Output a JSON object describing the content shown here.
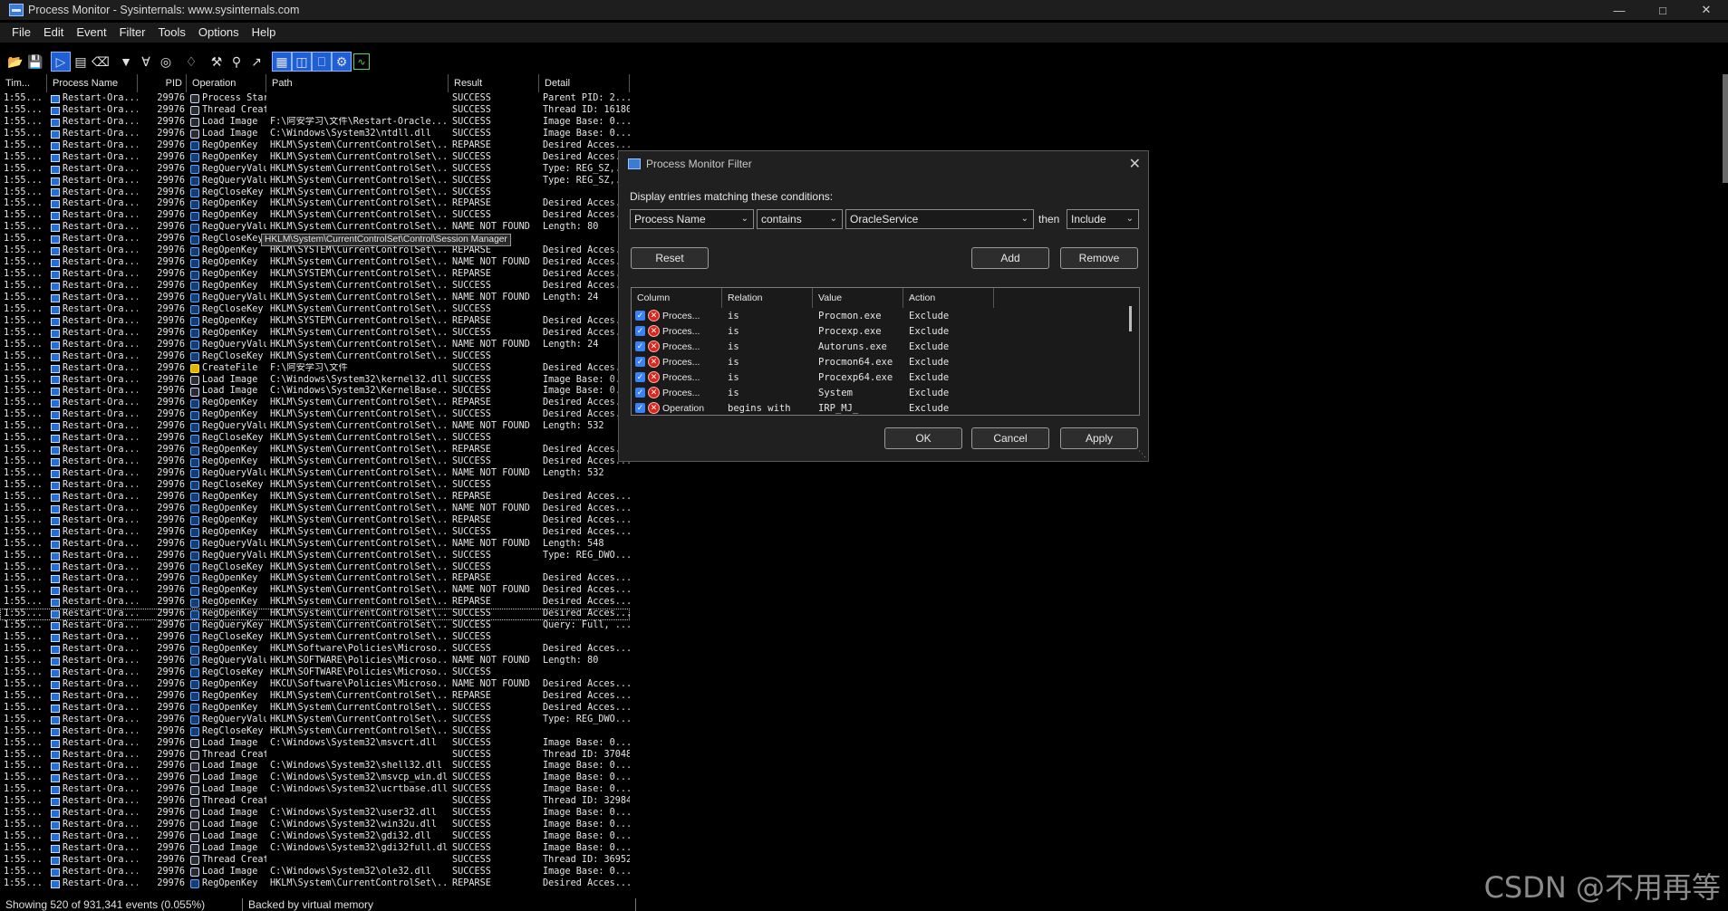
{
  "window": {
    "title": "Process Monitor - Sysinternals: www.sysinternals.com",
    "controls": [
      "minimize-icon",
      "maximize-icon",
      "close-icon"
    ]
  },
  "menu": [
    "File",
    "Edit",
    "Event",
    "Filter",
    "Tools",
    "Options",
    "Help"
  ],
  "toolbar": [
    "open-icon",
    "save-icon",
    "capture-icon",
    "autoscroll-icon",
    "clear-icon",
    "filter-icon",
    "highlight-icon",
    "target-icon",
    "process-tree-icon",
    "wrench-icon",
    "find-icon",
    "jump-icon",
    "registry-activity-icon",
    "file-activity-icon",
    "network-activity-icon",
    "process-activity-icon",
    "profiling-icon"
  ],
  "columns": [
    "Tim...",
    "Process Name",
    "PID",
    "Operation",
    "Path",
    "Result",
    "Detail"
  ],
  "rows": [
    [
      "1:55...",
      "Restart-Ora...",
      "29976",
      "proc",
      "Process Start",
      "",
      "SUCCESS",
      "Parent PID: 2..."
    ],
    [
      "1:55...",
      "Restart-Ora...",
      "29976",
      "proc",
      "Thread Create",
      "",
      "SUCCESS",
      "Thread ID: 16180"
    ],
    [
      "1:55...",
      "Restart-Ora...",
      "29976",
      "proc",
      "Load Image",
      "F:\\阿安学习\\文件\\Restart-Oracle...",
      "SUCCESS",
      "Image Base: 0..."
    ],
    [
      "1:55...",
      "Restart-Ora...",
      "29976",
      "proc",
      "Load Image",
      "C:\\Windows\\System32\\ntdll.dll",
      "SUCCESS",
      "Image Base: 0..."
    ],
    [
      "1:55...",
      "Restart-Ora...",
      "29976",
      "reg",
      "RegOpenKey",
      "HKLM\\System\\CurrentControlSet\\...",
      "REPARSE",
      "Desired Acces..."
    ],
    [
      "1:55...",
      "Restart-Ora...",
      "29976",
      "reg",
      "RegOpenKey",
      "HKLM\\System\\CurrentControlSet\\...",
      "SUCCESS",
      "Desired Acces..."
    ],
    [
      "1:55...",
      "Restart-Ora...",
      "29976",
      "reg",
      "RegQueryValue",
      "HKLM\\System\\CurrentControlSet\\...",
      "SUCCESS",
      "Type: REG_SZ,..."
    ],
    [
      "1:55...",
      "Restart-Ora...",
      "29976",
      "reg",
      "RegQueryValue",
      "HKLM\\System\\CurrentControlSet\\...",
      "SUCCESS",
      "Type: REG_SZ,..."
    ],
    [
      "1:55...",
      "Restart-Ora...",
      "29976",
      "reg",
      "RegCloseKey",
      "HKLM\\System\\CurrentControlSet\\...",
      "SUCCESS",
      ""
    ],
    [
      "1:55...",
      "Restart-Ora...",
      "29976",
      "reg",
      "RegOpenKey",
      "HKLM\\System\\CurrentControlSet\\...",
      "REPARSE",
      "Desired Acces..."
    ],
    [
      "1:55...",
      "Restart-Ora...",
      "29976",
      "reg",
      "RegOpenKey",
      "HKLM\\System\\CurrentControlSet\\...",
      "SUCCESS",
      "Desired Acces..."
    ],
    [
      "1:55...",
      "Restart-Ora...",
      "29976",
      "reg",
      "RegQueryValue",
      "HKLM\\System\\CurrentControlSet\\...",
      "NAME NOT FOUND",
      "Length: 80"
    ],
    [
      "1:55...",
      "Restart-Ora...",
      "29976",
      "reg",
      "RegCloseKey",
      "",
      "",
      ""
    ],
    [
      "1:55...",
      "Restart-Ora...",
      "29976",
      "reg",
      "RegOpenKey",
      "HKLM\\SYSTEM\\CurrentControlSet\\...",
      "REPARSE",
      "Desired Acces..."
    ],
    [
      "1:55...",
      "Restart-Ora...",
      "29976",
      "reg",
      "RegOpenKey",
      "HKLM\\System\\CurrentControlSet\\...",
      "NAME NOT FOUND",
      "Desired Acces..."
    ],
    [
      "1:55...",
      "Restart-Ora...",
      "29976",
      "reg",
      "RegOpenKey",
      "HKLM\\SYSTEM\\CurrentControlSet\\...",
      "REPARSE",
      "Desired Acces..."
    ],
    [
      "1:55...",
      "Restart-Ora...",
      "29976",
      "reg",
      "RegOpenKey",
      "HKLM\\System\\CurrentControlSet\\...",
      "SUCCESS",
      "Desired Acces..."
    ],
    [
      "1:55...",
      "Restart-Ora...",
      "29976",
      "reg",
      "RegQueryValue",
      "HKLM\\System\\CurrentControlSet\\...",
      "NAME NOT FOUND",
      "Length: 24"
    ],
    [
      "1:55...",
      "Restart-Ora...",
      "29976",
      "reg",
      "RegCloseKey",
      "HKLM\\System\\CurrentControlSet\\...",
      "SUCCESS",
      ""
    ],
    [
      "1:55...",
      "Restart-Ora...",
      "29976",
      "reg",
      "RegOpenKey",
      "HKLM\\SYSTEM\\CurrentControlSet\\...",
      "REPARSE",
      "Desired Acces..."
    ],
    [
      "1:55...",
      "Restart-Ora...",
      "29976",
      "reg",
      "RegOpenKey",
      "HKLM\\System\\CurrentControlSet\\...",
      "SUCCESS",
      "Desired Acces..."
    ],
    [
      "1:55...",
      "Restart-Ora...",
      "29976",
      "reg",
      "RegQueryValue",
      "HKLM\\System\\CurrentControlSet\\...",
      "NAME NOT FOUND",
      "Length: 24"
    ],
    [
      "1:55...",
      "Restart-Ora...",
      "29976",
      "reg",
      "RegCloseKey",
      "HKLM\\System\\CurrentControlSet\\...",
      "SUCCESS",
      ""
    ],
    [
      "1:55...",
      "Restart-Ora...",
      "29976",
      "file",
      "CreateFile",
      "F:\\阿安学习\\文件",
      "SUCCESS",
      "Desired Acces..."
    ],
    [
      "1:55...",
      "Restart-Ora...",
      "29976",
      "proc",
      "Load Image",
      "C:\\Windows\\System32\\kernel32.dll",
      "SUCCESS",
      "Image Base: 0..."
    ],
    [
      "1:55...",
      "Restart-Ora...",
      "29976",
      "proc",
      "Load Image",
      "C:\\Windows\\System32\\KernelBase...",
      "SUCCESS",
      "Image Base: 0..."
    ],
    [
      "1:55...",
      "Restart-Ora...",
      "29976",
      "reg",
      "RegOpenKey",
      "HKLM\\System\\CurrentControlSet\\...",
      "REPARSE",
      "Desired Acces..."
    ],
    [
      "1:55...",
      "Restart-Ora...",
      "29976",
      "reg",
      "RegOpenKey",
      "HKLM\\System\\CurrentControlSet\\...",
      "SUCCESS",
      "Desired Acces..."
    ],
    [
      "1:55...",
      "Restart-Ora...",
      "29976",
      "reg",
      "RegQueryValue",
      "HKLM\\System\\CurrentControlSet\\...",
      "NAME NOT FOUND",
      "Length: 532"
    ],
    [
      "1:55...",
      "Restart-Ora...",
      "29976",
      "reg",
      "RegCloseKey",
      "HKLM\\System\\CurrentControlSet\\...",
      "SUCCESS",
      ""
    ],
    [
      "1:55...",
      "Restart-Ora...",
      "29976",
      "reg",
      "RegOpenKey",
      "HKLM\\System\\CurrentControlSet\\...",
      "REPARSE",
      "Desired Acces..."
    ],
    [
      "1:55...",
      "Restart-Ora...",
      "29976",
      "reg",
      "RegOpenKey",
      "HKLM\\System\\CurrentControlSet\\...",
      "SUCCESS",
      "Desired Acces..."
    ],
    [
      "1:55...",
      "Restart-Ora...",
      "29976",
      "reg",
      "RegQueryValue",
      "HKLM\\System\\CurrentControlSet\\...",
      "NAME NOT FOUND",
      "Length: 532"
    ],
    [
      "1:55...",
      "Restart-Ora...",
      "29976",
      "reg",
      "RegCloseKey",
      "HKLM\\System\\CurrentControlSet\\...",
      "SUCCESS",
      ""
    ],
    [
      "1:55...",
      "Restart-Ora...",
      "29976",
      "reg",
      "RegOpenKey",
      "HKLM\\System\\CurrentControlSet\\...",
      "REPARSE",
      "Desired Acces..."
    ],
    [
      "1:55...",
      "Restart-Ora...",
      "29976",
      "reg",
      "RegOpenKey",
      "HKLM\\System\\CurrentControlSet\\...",
      "NAME NOT FOUND",
      "Desired Acces..."
    ],
    [
      "1:55...",
      "Restart-Ora...",
      "29976",
      "reg",
      "RegOpenKey",
      "HKLM\\System\\CurrentControlSet\\...",
      "REPARSE",
      "Desired Acces..."
    ],
    [
      "1:55...",
      "Restart-Ora...",
      "29976",
      "reg",
      "RegOpenKey",
      "HKLM\\System\\CurrentControlSet\\...",
      "SUCCESS",
      "Desired Acces..."
    ],
    [
      "1:55...",
      "Restart-Ora...",
      "29976",
      "reg",
      "RegQueryValue",
      "HKLM\\System\\CurrentControlSet\\...",
      "NAME NOT FOUND",
      "Length: 548"
    ],
    [
      "1:55...",
      "Restart-Ora...",
      "29976",
      "reg",
      "RegQueryValue",
      "HKLM\\System\\CurrentControlSet\\...",
      "SUCCESS",
      "Type: REG_DWO..."
    ],
    [
      "1:55...",
      "Restart-Ora...",
      "29976",
      "reg",
      "RegCloseKey",
      "HKLM\\System\\CurrentControlSet\\...",
      "SUCCESS",
      ""
    ],
    [
      "1:55...",
      "Restart-Ora...",
      "29976",
      "reg",
      "RegOpenKey",
      "HKLM\\System\\CurrentControlSet\\...",
      "REPARSE",
      "Desired Acces..."
    ],
    [
      "1:55...",
      "Restart-Ora...",
      "29976",
      "reg",
      "RegOpenKey",
      "HKLM\\System\\CurrentControlSet\\...",
      "NAME NOT FOUND",
      "Desired Acces..."
    ],
    [
      "1:55...",
      "Restart-Ora...",
      "29976",
      "reg",
      "RegOpenKey",
      "HKLM\\System\\CurrentControlSet\\...",
      "REPARSE",
      "Desired Acces..."
    ],
    [
      "1:55...",
      "Restart-Ora...",
      "29976",
      "reg",
      "RegOpenKey",
      "HKLM\\System\\CurrentControlSet\\...",
      "SUCCESS",
      "Desired Acces..."
    ],
    [
      "1:55...",
      "Restart-Ora...",
      "29976",
      "reg",
      "RegQueryKey",
      "HKLM\\System\\CurrentControlSet\\...",
      "SUCCESS",
      "Query: Full, ..."
    ],
    [
      "1:55...",
      "Restart-Ora...",
      "29976",
      "reg",
      "RegCloseKey",
      "HKLM\\System\\CurrentControlSet\\...",
      "SUCCESS",
      ""
    ],
    [
      "1:55...",
      "Restart-Ora...",
      "29976",
      "reg",
      "RegOpenKey",
      "HKLM\\Software\\Policies\\Microso...",
      "SUCCESS",
      "Desired Acces..."
    ],
    [
      "1:55...",
      "Restart-Ora...",
      "29976",
      "reg",
      "RegQueryValue",
      "HKLM\\SOFTWARE\\Policies\\Microso...",
      "NAME NOT FOUND",
      "Length: 80"
    ],
    [
      "1:55...",
      "Restart-Ora...",
      "29976",
      "reg",
      "RegCloseKey",
      "HKLM\\SOFTWARE\\Policies\\Microso...",
      "SUCCESS",
      ""
    ],
    [
      "1:55...",
      "Restart-Ora...",
      "29976",
      "reg",
      "RegOpenKey",
      "HKCU\\Software\\Policies\\Microso...",
      "NAME NOT FOUND",
      "Desired Acces..."
    ],
    [
      "1:55...",
      "Restart-Ora...",
      "29976",
      "reg",
      "RegOpenKey",
      "HKLM\\System\\CurrentControlSet\\...",
      "REPARSE",
      "Desired Acces..."
    ],
    [
      "1:55...",
      "Restart-Ora...",
      "29976",
      "reg",
      "RegOpenKey",
      "HKLM\\System\\CurrentControlSet\\...",
      "SUCCESS",
      "Desired Acces..."
    ],
    [
      "1:55...",
      "Restart-Ora...",
      "29976",
      "reg",
      "RegQueryValue",
      "HKLM\\System\\CurrentControlSet\\...",
      "SUCCESS",
      "Type: REG_DWO..."
    ],
    [
      "1:55...",
      "Restart-Ora...",
      "29976",
      "reg",
      "RegCloseKey",
      "HKLM\\System\\CurrentControlSet\\...",
      "SUCCESS",
      ""
    ],
    [
      "1:55...",
      "Restart-Ora...",
      "29976",
      "proc",
      "Load Image",
      "C:\\Windows\\System32\\msvcrt.dll",
      "SUCCESS",
      "Image Base: 0..."
    ],
    [
      "1:55...",
      "Restart-Ora...",
      "29976",
      "proc",
      "Thread Create",
      "",
      "SUCCESS",
      "Thread ID: 37048"
    ],
    [
      "1:55...",
      "Restart-Ora...",
      "29976",
      "proc",
      "Load Image",
      "C:\\Windows\\System32\\shell32.dll",
      "SUCCESS",
      "Image Base: 0..."
    ],
    [
      "1:55...",
      "Restart-Ora...",
      "29976",
      "proc",
      "Load Image",
      "C:\\Windows\\System32\\msvcp_win.dll",
      "SUCCESS",
      "Image Base: 0..."
    ],
    [
      "1:55...",
      "Restart-Ora...",
      "29976",
      "proc",
      "Load Image",
      "C:\\Windows\\System32\\ucrtbase.dll",
      "SUCCESS",
      "Image Base: 0..."
    ],
    [
      "1:55...",
      "Restart-Ora...",
      "29976",
      "proc",
      "Thread Create",
      "",
      "SUCCESS",
      "Thread ID: 32984"
    ],
    [
      "1:55...",
      "Restart-Ora...",
      "29976",
      "proc",
      "Load Image",
      "C:\\Windows\\System32\\user32.dll",
      "SUCCESS",
      "Image Base: 0..."
    ],
    [
      "1:55...",
      "Restart-Ora...",
      "29976",
      "proc",
      "Load Image",
      "C:\\Windows\\System32\\win32u.dll",
      "SUCCESS",
      "Image Base: 0..."
    ],
    [
      "1:55...",
      "Restart-Ora...",
      "29976",
      "proc",
      "Load Image",
      "C:\\Windows\\System32\\gdi32.dll",
      "SUCCESS",
      "Image Base: 0..."
    ],
    [
      "1:55...",
      "Restart-Ora...",
      "29976",
      "proc",
      "Load Image",
      "C:\\Windows\\System32\\gdi32full.dll",
      "SUCCESS",
      "Image Base: 0..."
    ],
    [
      "1:55...",
      "Restart-Ora...",
      "29976",
      "proc",
      "Thread Create",
      "",
      "SUCCESS",
      "Thread ID: 36952"
    ],
    [
      "1:55...",
      "Restart-Ora...",
      "29976",
      "proc",
      "Load Image",
      "C:\\Windows\\System32\\ole32.dll",
      "SUCCESS",
      "Image Base: 0..."
    ],
    [
      "1:55...",
      "Restart-Ora...",
      "29976",
      "reg",
      "RegOpenKey",
      "HKLM\\System\\CurrentControlSet\\...",
      "REPARSE",
      "Desired Acces..."
    ]
  ],
  "selected_row": 44,
  "tooltip": "HKLM\\System\\CurrentControlSet\\Control\\Session Manager",
  "status": {
    "events": "Showing 520 of 931,341 events (0.055%)",
    "memory": "Backed by virtual memory"
  },
  "watermark": "CSDN @不用再等",
  "dialog": {
    "title": "Process Monitor Filter",
    "prompt": "Display entries matching these conditions:",
    "column_value": "Process Name",
    "relation_value": "contains",
    "value_value": "OracleService",
    "then_label": "then",
    "action_value": "Include",
    "reset_label": "Reset",
    "add_label": "Add",
    "remove_label": "Remove",
    "table_headers": [
      "Column",
      "Relation",
      "Value",
      "Action"
    ],
    "conditions": [
      [
        "Proces...",
        "is",
        "Procmon.exe",
        "Exclude"
      ],
      [
        "Proces...",
        "is",
        "Procexp.exe",
        "Exclude"
      ],
      [
        "Proces...",
        "is",
        "Autoruns.exe",
        "Exclude"
      ],
      [
        "Proces...",
        "is",
        "Procmon64.exe",
        "Exclude"
      ],
      [
        "Proces...",
        "is",
        "Procexp64.exe",
        "Exclude"
      ],
      [
        "Proces...",
        "is",
        "System",
        "Exclude"
      ],
      [
        "Operation",
        "begins with",
        "IRP_MJ_",
        "Exclude"
      ]
    ],
    "ok_label": "OK",
    "cancel_label": "Cancel",
    "apply_label": "Apply"
  }
}
